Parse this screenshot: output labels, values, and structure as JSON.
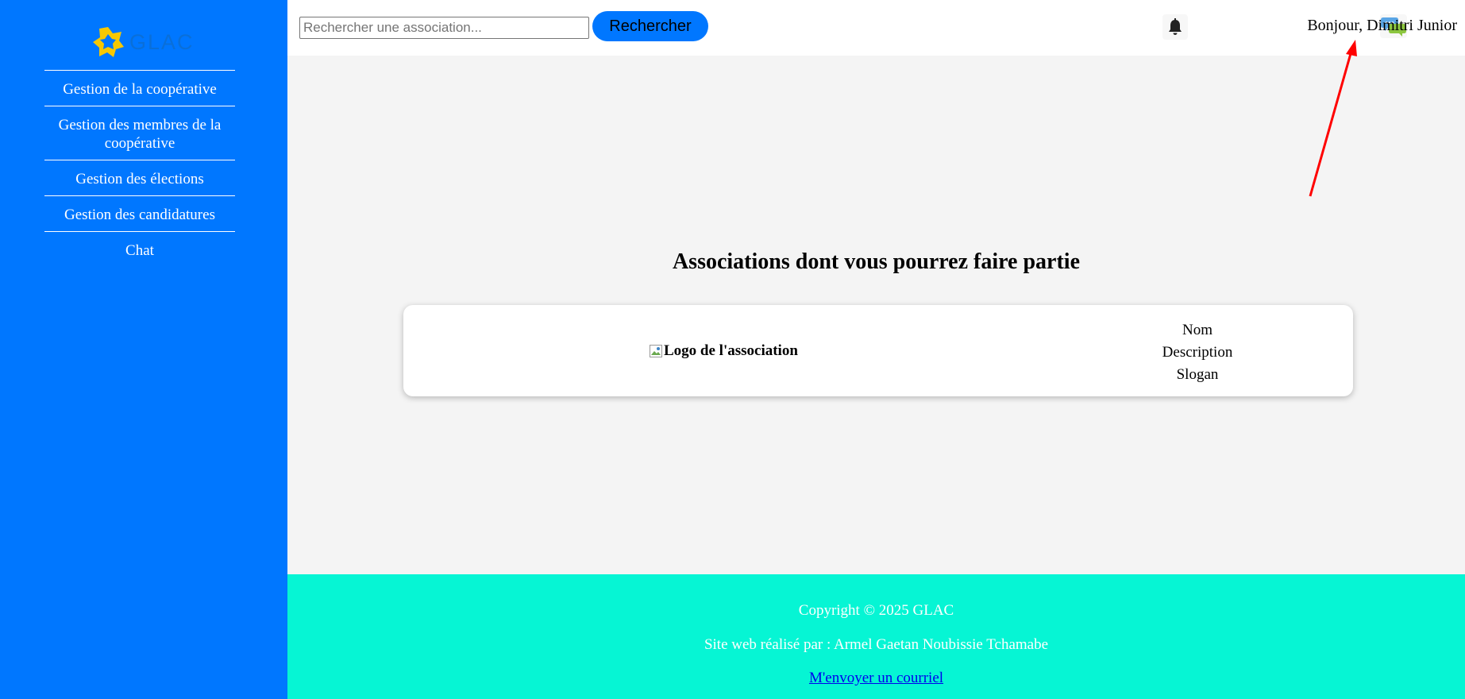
{
  "brand": {
    "name": "GLAC",
    "logo_colors": {
      "mark": "#f7c800",
      "text": "#0a6fd8"
    }
  },
  "sidebar": {
    "background": "#0077ff",
    "items": [
      {
        "label": "Gestion de la coopérative"
      },
      {
        "label": "Gestion des membres de la coopérative"
      },
      {
        "label": "Gestion des élections"
      },
      {
        "label": "Gestion des candidatures"
      },
      {
        "label": "Chat"
      }
    ]
  },
  "header": {
    "search": {
      "placeholder": "Rechercher une association...",
      "value": ""
    },
    "search_button_label": "Rechercher",
    "notification_icon": "bell-icon",
    "chat_icon": "chat-bubbles-icon",
    "greeting": "Bonjour, Dimitri Junior"
  },
  "annotation": {
    "type": "arrow",
    "color": "#ff0000"
  },
  "main": {
    "title": "Associations dont vous pourrez faire partie",
    "associations": [
      {
        "logo_alt": "Logo de l'association",
        "name": "Nom",
        "description": "Description",
        "slogan": "Slogan"
      }
    ]
  },
  "footer": {
    "background": "#06f5d4",
    "copyright": "Copyright © 2025 GLAC",
    "credit": "Site web réalisé par : Armel Gaetan Noubissie Tchamabe",
    "email_link": "M'envoyer un courriel"
  }
}
